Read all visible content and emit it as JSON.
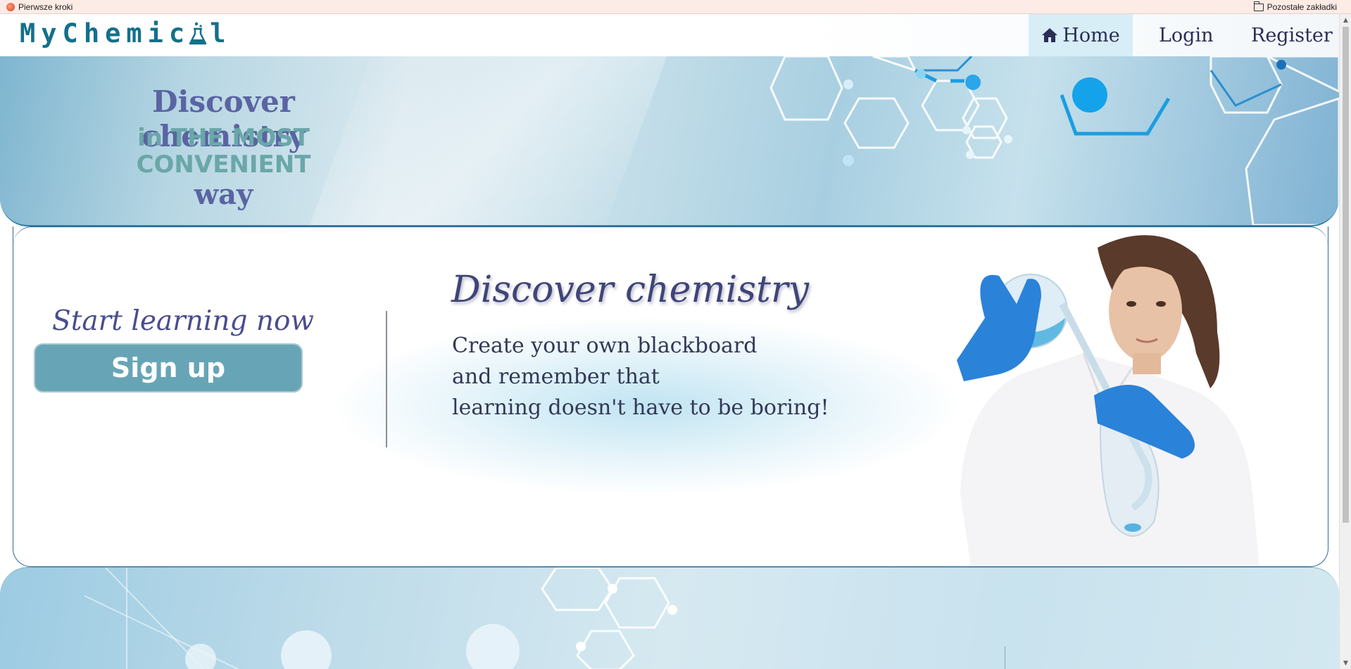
{
  "bookmarks": {
    "left_item": "Pierwsze kroki",
    "right_item": "Pozostałe zakładki"
  },
  "nav": {
    "logo": "MyChemic l",
    "logo_left": "MyChemic",
    "logo_right": "l",
    "home": "Home",
    "login": "Login",
    "register": "Register"
  },
  "hero": {
    "line1": "Discover chemistry",
    "line2": "in THE MOST",
    "line3": "CONVENIENT",
    "line4": "way"
  },
  "main": {
    "start_text": "Start learning now",
    "signup_label": "Sign up",
    "title": "Discover chemistry",
    "tagline_1": "Create your own blackboard",
    "tagline_2": "and remember that",
    "tagline_3": "learning doesn't have to be boring!"
  },
  "colors": {
    "accent": "#14708a",
    "signup": "#67a5b6",
    "heading": "#5a64a2"
  }
}
